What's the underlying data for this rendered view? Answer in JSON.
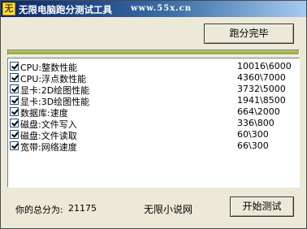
{
  "window": {
    "app_icon": "无",
    "title": "无限电脑跑分测试工具",
    "url": "www.55x.cn"
  },
  "toolbar": {
    "score_done_label": "跑分完毕",
    "start_label": "开始测试"
  },
  "progress": {
    "percent": 100,
    "color": "#9aae45"
  },
  "tests": [
    {
      "label": "CPU:整数性能",
      "value": "10016\\6000",
      "checked": true
    },
    {
      "label": "CPU:浮点数性能",
      "value": "4360\\7000",
      "checked": true
    },
    {
      "label": "显卡:2D绘图性能",
      "value": "3732\\5000",
      "checked": true
    },
    {
      "label": "显卡:3D绘图性能",
      "value": "1941\\8500",
      "checked": true
    },
    {
      "label": "数据库:速度",
      "value": "664\\2000",
      "checked": true
    },
    {
      "label": "磁盘:文件写入",
      "value": "336\\800",
      "checked": true
    },
    {
      "label": "磁盘:文件读取",
      "value": "60\\300",
      "checked": true
    },
    {
      "label": "宽带:网络速度",
      "value": "66\\300",
      "checked": true
    }
  ],
  "footer": {
    "total_label": "你的总分为:",
    "total_value": "21175",
    "site_name": "无限小说网"
  }
}
